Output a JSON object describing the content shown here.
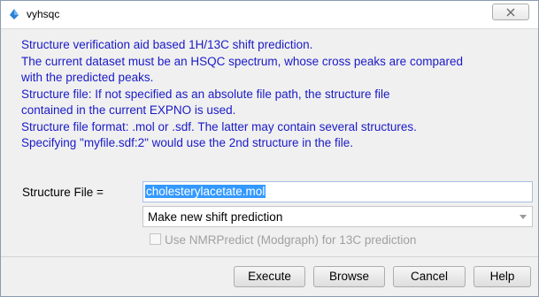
{
  "window": {
    "title": "vyhsqc",
    "icon": "spectrum-app-icon",
    "close_icon": "close-x-icon"
  },
  "info_lines": [
    "Structure verification aid based 1H/13C shift prediction.",
    "The current dataset must be an HSQC spectrum, whose cross peaks are compared",
    "with the predicted peaks.",
    "Structure file: If not specified as an absolute file path, the structure file",
    "contained in the current EXPNO is used.",
    "Structure file format: .mol or .sdf. The latter may contain several structures.",
    "Specifying \"myfile.sdf:2\" would use the 2nd structure in the file."
  ],
  "form": {
    "structure_label": "Structure File =",
    "structure_value": "cholesterylacetate.mol",
    "prediction_mode": "Make new shift prediction",
    "nmrpredict_label": "Use NMRPredict (Modgraph) for 13C prediction",
    "nmrpredict_checked": false,
    "nmrpredict_enabled": false
  },
  "buttons": {
    "execute": "Execute",
    "browse": "Browse",
    "cancel": "Cancel",
    "help": "Help"
  },
  "colors": {
    "info_text": "#1a1ac8",
    "selection": "#3399ff",
    "disabled_text": "#a0a0a0"
  }
}
